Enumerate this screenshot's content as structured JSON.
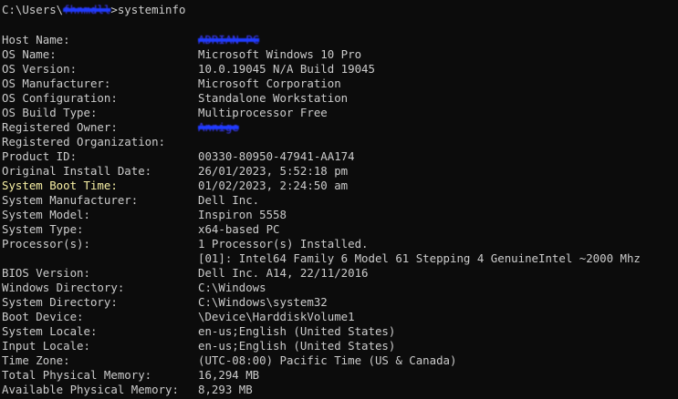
{
  "prompt": {
    "path_prefix": "C:\\Users\\",
    "username_redacted": "fhnmdll",
    "path_suffix": ">systeminfo"
  },
  "rows": [
    {
      "key": "Host Name:",
      "value": "ADRIAN-PC",
      "redacted": true
    },
    {
      "key": "OS Name:",
      "value": "Microsoft Windows 10 Pro"
    },
    {
      "key": "OS Version:",
      "value": "10.0.19045 N/A Build 19045"
    },
    {
      "key": "OS Manufacturer:",
      "value": "Microsoft Corporation"
    },
    {
      "key": "OS Configuration:",
      "value": "Standalone Workstation"
    },
    {
      "key": "OS Build Type:",
      "value": "Multiprocessor Free"
    },
    {
      "key": "Registered Owner:",
      "value": "Annige",
      "redacted": true
    },
    {
      "key": "Registered Organization:",
      "value": ""
    },
    {
      "key": "Product ID:",
      "value": "00330-80950-47941-AA174"
    },
    {
      "key": "Original Install Date:",
      "value": "26/01/2023, 5:52:18 pm"
    },
    {
      "key": "System Boot Time:",
      "value": "01/02/2023, 2:24:50 am",
      "highlight": true
    },
    {
      "key": "System Manufacturer:",
      "value": "Dell Inc."
    },
    {
      "key": "System Model:",
      "value": "Inspiron 5558"
    },
    {
      "key": "System Type:",
      "value": "x64-based PC"
    },
    {
      "key": "Processor(s):",
      "value": "1 Processor(s) Installed."
    },
    {
      "key": "",
      "value": "[01]: Intel64 Family 6 Model 61 Stepping 4 GenuineIntel ~2000 Mhz"
    },
    {
      "key": "BIOS Version:",
      "value": "Dell Inc. A14, 22/11/2016"
    },
    {
      "key": "Windows Directory:",
      "value": "C:\\Windows"
    },
    {
      "key": "System Directory:",
      "value": "C:\\Windows\\system32"
    },
    {
      "key": "Boot Device:",
      "value": "\\Device\\HarddiskVolume1"
    },
    {
      "key": "System Locale:",
      "value": "en-us;English (United States)"
    },
    {
      "key": "Input Locale:",
      "value": "en-us;English (United States)"
    },
    {
      "key": "Time Zone:",
      "value": "(UTC-08:00) Pacific Time (US & Canada)"
    },
    {
      "key": "Total Physical Memory:",
      "value": "16,294 MB"
    },
    {
      "key": "Available Physical Memory:",
      "value": "8,293 MB"
    }
  ],
  "colors": {
    "background": "#0c0c0c",
    "text": "#cccccc",
    "highlight": "#f9f1a5",
    "redaction": "#1f3bff"
  }
}
